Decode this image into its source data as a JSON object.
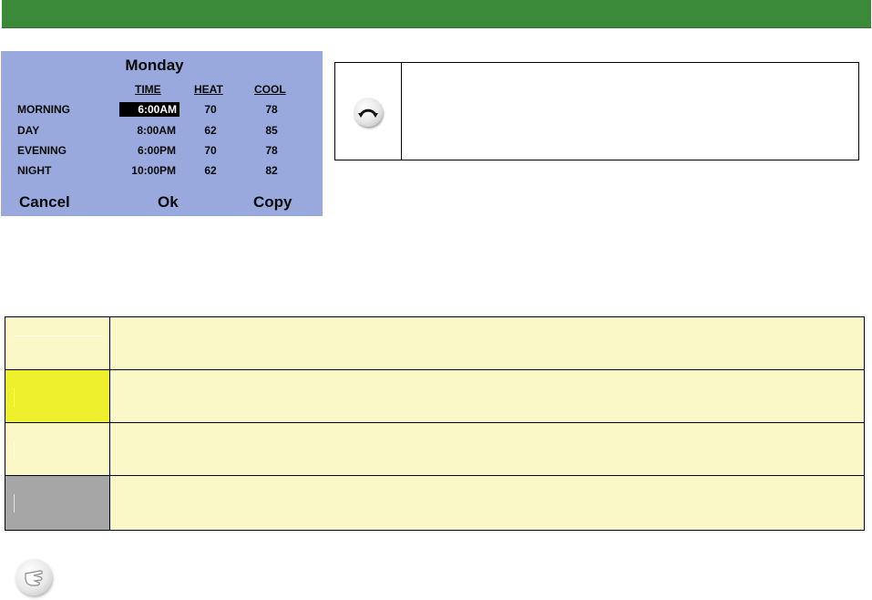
{
  "schedule": {
    "day": "Monday",
    "headers": {
      "time": "TIME",
      "heat": "HEAT",
      "cool": "COOL"
    },
    "rows": [
      {
        "label": "MORNING",
        "time": "6:00AM",
        "heat": "70",
        "cool": "78"
      },
      {
        "label": "DAY",
        "time": "8:00AM",
        "heat": "62",
        "cool": "85"
      },
      {
        "label": "EVENING",
        "time": "6:00PM",
        "heat": "70",
        "cool": "78"
      },
      {
        "label": "NIGHT",
        "time": "10:00PM",
        "heat": "62",
        "cool": "82"
      }
    ],
    "softkeys": {
      "cancel": "Cancel",
      "ok": "Ok",
      "copy": "Copy"
    }
  },
  "icons": {
    "info": "rotate-knob-icon",
    "note": "hand-pointer-icon"
  },
  "colors": {
    "header_bar": "#3a8a3a",
    "panel": "#9aa9dd",
    "row_bg": "#faf8c6",
    "swatches": [
      "#faf8c6",
      "#eef02e",
      "#faf8c6",
      "#a6a6a6"
    ]
  }
}
